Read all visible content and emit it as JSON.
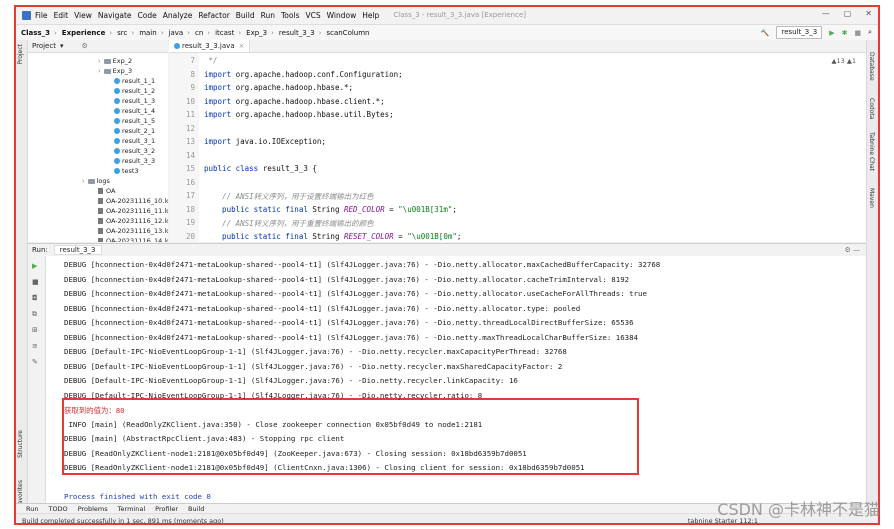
{
  "menu": {
    "items": [
      "File",
      "Edit",
      "View",
      "Navigate",
      "Code",
      "Analyze",
      "Refactor",
      "Build",
      "Run",
      "Tools",
      "VCS",
      "Window",
      "Help"
    ],
    "window_title": "Class_3 - result_3_3.java [Experience]"
  },
  "breadcrumbs": [
    "Class_3",
    "Experience",
    "src",
    "main",
    "java",
    "cn",
    "itcast",
    "Exp_3",
    "result_3_3",
    "scanColumn"
  ],
  "toolbar": {
    "run_config": "result_3_3"
  },
  "project": {
    "header": "Project",
    "tree": [
      {
        "label": "Exp_2",
        "kind": "folder",
        "indent": 0
      },
      {
        "label": "Exp_3",
        "kind": "folder",
        "indent": 0
      },
      {
        "label": "result_1_1",
        "kind": "class",
        "indent": 1
      },
      {
        "label": "result_1_2",
        "kind": "class",
        "indent": 1
      },
      {
        "label": "result_1_3",
        "kind": "class",
        "indent": 1
      },
      {
        "label": "result_1_4",
        "kind": "class",
        "indent": 1
      },
      {
        "label": "result_1_5",
        "kind": "class",
        "indent": 1
      },
      {
        "label": "result_2_1",
        "kind": "class",
        "indent": 1
      },
      {
        "label": "result_3_1",
        "kind": "class",
        "indent": 1
      },
      {
        "label": "result_3_2",
        "kind": "class",
        "indent": 1
      },
      {
        "label": "result_3_3",
        "kind": "class",
        "indent": 1
      },
      {
        "label": "test3",
        "kind": "class",
        "indent": 1
      },
      {
        "label": "logs",
        "kind": "folder",
        "indent": -1
      },
      {
        "label": "OA",
        "kind": "log",
        "indent": 0
      },
      {
        "label": "OA-20231116_10.lo",
        "kind": "log",
        "indent": 0
      },
      {
        "label": "OA-20231116_11.lo",
        "kind": "log",
        "indent": 0
      },
      {
        "label": "OA-20231116_12.lo",
        "kind": "log",
        "indent": 0
      },
      {
        "label": "OA-20231116_13.lo",
        "kind": "log",
        "indent": 0
      },
      {
        "label": "OA-20231116_14.lo",
        "kind": "log",
        "indent": 0
      }
    ]
  },
  "editor": {
    "tab": "result_3_3.java",
    "inspections": "▲13 ▲1",
    "lines": [
      {
        "n": "7",
        "segs": [
          {
            "t": " */",
            "c": "cm"
          }
        ]
      },
      {
        "n": "8",
        "segs": [
          {
            "t": "import ",
            "c": "kw"
          },
          {
            "t": "org.apache.hadoop.conf.Configuration;",
            "c": ""
          }
        ]
      },
      {
        "n": "9",
        "segs": [
          {
            "t": "import ",
            "c": "kw"
          },
          {
            "t": "org.apache.hadoop.hbase.*;",
            "c": ""
          }
        ]
      },
      {
        "n": "10",
        "segs": [
          {
            "t": "import ",
            "c": "kw"
          },
          {
            "t": "org.apache.hadoop.hbase.client.*;",
            "c": ""
          }
        ]
      },
      {
        "n": "11",
        "segs": [
          {
            "t": "import ",
            "c": "kw"
          },
          {
            "t": "org.apache.hadoop.hbase.util.Bytes;",
            "c": ""
          }
        ]
      },
      {
        "n": "12",
        "segs": []
      },
      {
        "n": "13",
        "segs": [
          {
            "t": "import ",
            "c": "kw"
          },
          {
            "t": "java.io.IOException;",
            "c": ""
          }
        ]
      },
      {
        "n": "14",
        "segs": []
      },
      {
        "n": "15",
        "segs": [
          {
            "t": "public class ",
            "c": "kw"
          },
          {
            "t": "result_3_3 {",
            "c": ""
          }
        ]
      },
      {
        "n": "16",
        "segs": []
      },
      {
        "n": "17",
        "segs": [
          {
            "t": "    // ANSI转义序列，用于设置终端输出为红色",
            "c": "cm"
          }
        ]
      },
      {
        "n": "18",
        "segs": [
          {
            "t": "    public static final ",
            "c": "kw"
          },
          {
            "t": "String ",
            "c": ""
          },
          {
            "t": "RED_COLOR",
            "c": "cn"
          },
          {
            "t": " = ",
            "c": ""
          },
          {
            "t": "\"\\u001B[31m\"",
            "c": "st"
          },
          {
            "t": ";",
            "c": ""
          }
        ]
      },
      {
        "n": "19",
        "segs": [
          {
            "t": "    // ANSI转义序列，用于重置终端输出的颜色",
            "c": "cm"
          }
        ]
      },
      {
        "n": "20",
        "segs": [
          {
            "t": "    public static final ",
            "c": "kw"
          },
          {
            "t": "String ",
            "c": ""
          },
          {
            "t": "RESET_COLOR",
            "c": "cn"
          },
          {
            "t": " = ",
            "c": ""
          },
          {
            "t": "\"\\u001B[0m\"",
            "c": "st"
          },
          {
            "t": ";",
            "c": ""
          }
        ]
      }
    ]
  },
  "run": {
    "label": "Run:",
    "tab": "result_3_3",
    "output": [
      {
        "t": "DEBUG [hconnection-0x4d0f2471-metaLookup-shared--pool4-t1] (Slf4JLogger.java:76) - -Dio.netty.allocator.maxCachedBufferCapacity: 32768",
        "c": ""
      },
      {
        "t": "DEBUG [hconnection-0x4d0f2471-metaLookup-shared--pool4-t1] (Slf4JLogger.java:76) - -Dio.netty.allocator.cacheTrimInterval: 8192",
        "c": ""
      },
      {
        "t": "DEBUG [hconnection-0x4d0f2471-metaLookup-shared--pool4-t1] (Slf4JLogger.java:76) - -Dio.netty.allocator.useCacheForAllThreads: true",
        "c": ""
      },
      {
        "t": "DEBUG [hconnection-0x4d0f2471-metaLookup-shared--pool4-t1] (Slf4JLogger.java:76) - -Dio.netty.allocator.type: pooled",
        "c": ""
      },
      {
        "t": "DEBUG [hconnection-0x4d0f2471-metaLookup-shared--pool4-t1] (Slf4JLogger.java:76) - -Dio.netty.threadLocalDirectBufferSize: 65536",
        "c": ""
      },
      {
        "t": "DEBUG [hconnection-0x4d0f2471-metaLookup-shared--pool4-t1] (Slf4JLogger.java:76) - -Dio.netty.maxThreadLocalCharBufferSize: 16384",
        "c": ""
      },
      {
        "t": "DEBUG [Default-IPC-NioEventLoopGroup-1-1] (Slf4JLogger.java:76) - -Dio.netty.recycler.maxCapacityPerThread: 32768",
        "c": ""
      },
      {
        "t": "DEBUG [Default-IPC-NioEventLoopGroup-1-1] (Slf4JLogger.java:76) - -Dio.netty.recycler.maxSharedCapacityFactor: 2",
        "c": ""
      },
      {
        "t": "DEBUG [Default-IPC-NioEventLoopGroup-1-1] (Slf4JLogger.java:76) - -Dio.netty.recycler.linkCapacity: 16",
        "c": ""
      },
      {
        "t": "DEBUG [Default-IPC-NioEventLoopGroup-1-1] (Slf4JLogger.java:76) - -Dio.netty.recycler.ratio: 8",
        "c": ""
      },
      {
        "t": "获取到的值为：80",
        "c": "#d32f2f"
      },
      {
        "t": " INFO [main] (ReadOnlyZKClient.java:350) - Close zookeeper connection 0x05bf0d49 to node1:2181",
        "c": ""
      },
      {
        "t": "DEBUG [main] (AbstractRpcClient.java:483) - Stopping rpc client",
        "c": ""
      },
      {
        "t": "DEBUG [ReadOnlyZKClient-node1:2181@0x05bf0d49] (ZooKeeper.java:673) - Closing session: 0x18bd6359b7d0051",
        "c": ""
      },
      {
        "t": "DEBUG [ReadOnlyZKClient-node1:2181@0x05bf0d49] (ClientCnxn.java:1306) - Closing client for session: 0x18bd6359b7d0051",
        "c": ""
      },
      {
        "t": "",
        "c": ""
      },
      {
        "t": "Process finished with exit code 0",
        "c": "#1f3fb0"
      }
    ]
  },
  "bottom_tabs": [
    "Run",
    "TODO",
    "Problems",
    "Terminal",
    "Profiler",
    "Build"
  ],
  "status": {
    "message": "Build completed successfully in 1 sec, 891 ms (moments ago)",
    "right": "tabnine Starter 112:1"
  },
  "side_labels": {
    "left": [
      "Project",
      "Structure",
      "Favorites"
    ],
    "right": [
      "Database",
      "Codota",
      "Tabnine Chat",
      "Maven"
    ]
  },
  "watermark": "CSDN @卡林神不是猫"
}
